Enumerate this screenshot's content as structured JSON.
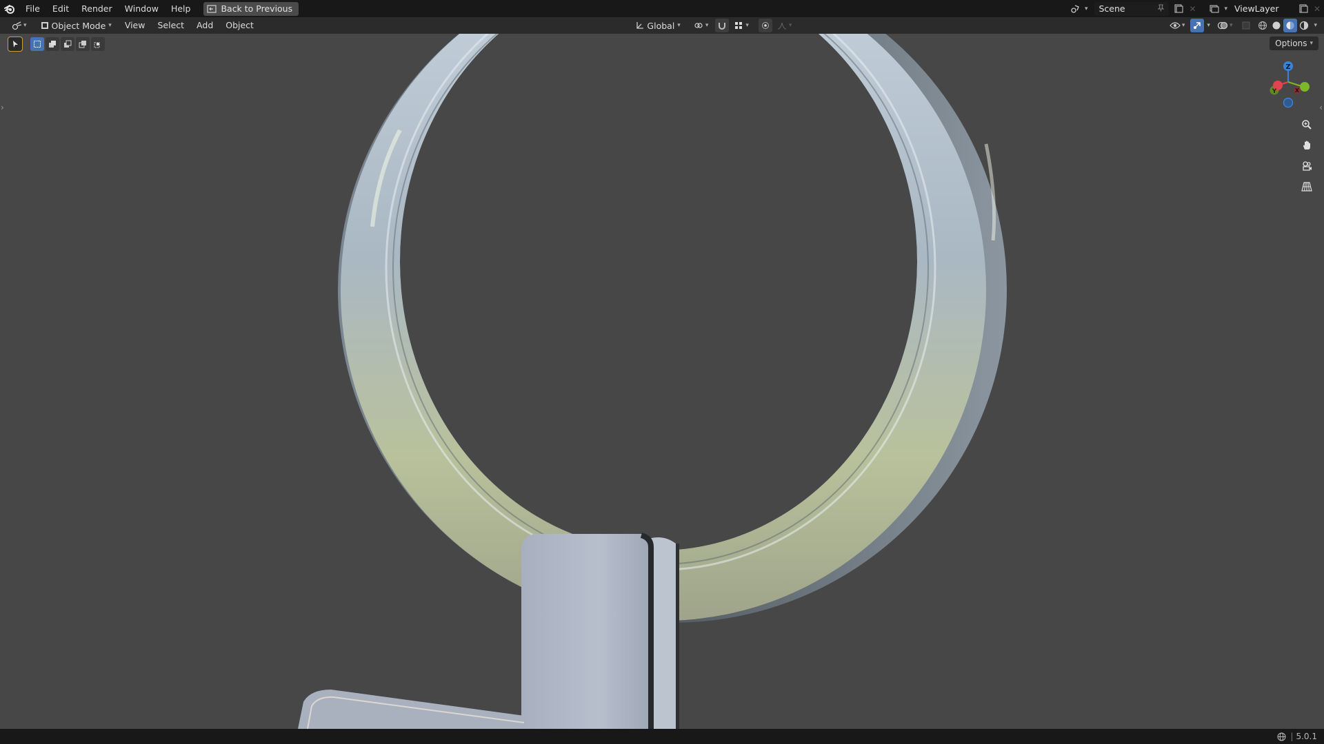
{
  "topbar": {
    "menus": [
      {
        "name": "menu-file",
        "label": "File"
      },
      {
        "name": "menu-edit",
        "label": "Edit"
      },
      {
        "name": "menu-render",
        "label": "Render"
      },
      {
        "name": "menu-window",
        "label": "Window"
      },
      {
        "name": "menu-help",
        "label": "Help"
      }
    ],
    "back_label": "Back to Previous",
    "scene_name": "Scene",
    "view_layer": "ViewLayer"
  },
  "viewport_header": {
    "mode": "Object Mode",
    "menus": [
      {
        "name": "menu-view",
        "label": "View"
      },
      {
        "name": "menu-select",
        "label": "Select"
      },
      {
        "name": "menu-add",
        "label": "Add"
      },
      {
        "name": "menu-object",
        "label": "Object"
      }
    ],
    "transform_orientation": "Global",
    "options_label": "Options"
  },
  "gizmo": {
    "x": "X",
    "y": "Y",
    "z": "Z",
    "x_color": "#e2444f",
    "y_color": "#7db82a",
    "z_color": "#3b83d6"
  },
  "statusbar": {
    "version": "5.0.1"
  },
  "colors": {
    "viewport_bg": "#474747",
    "topbar_bg": "#181818",
    "header_bg": "#2b2b2b",
    "accent": "#4772b3"
  }
}
